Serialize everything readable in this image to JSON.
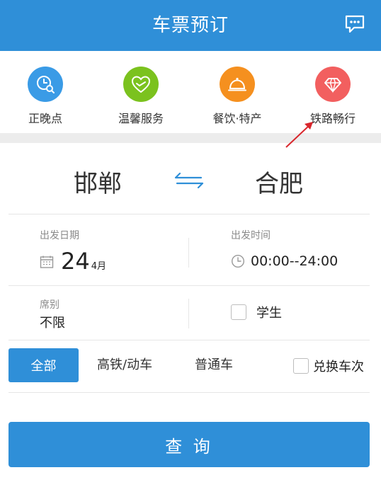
{
  "header": {
    "title": "车票预订",
    "chat_icon": "chat-bubble-icon"
  },
  "services": [
    {
      "label": "正晚点",
      "icon": "clock-search-icon",
      "color": "#3a9be6"
    },
    {
      "label": "温馨服务",
      "icon": "heart-handshake-icon",
      "color": "#7bc21e"
    },
    {
      "label": "餐饮·特产",
      "icon": "food-cloche-icon",
      "color": "#f5901f"
    },
    {
      "label": "铁路畅行",
      "icon": "diamond-icon",
      "color": "#f25f5f"
    }
  ],
  "route": {
    "from": "邯郸",
    "to": "合肥",
    "swap_icon": "swap-arrows-icon"
  },
  "departure_date": {
    "label": "出发日期",
    "day": "24",
    "month": "4月",
    "icon": "calendar-icon"
  },
  "departure_time": {
    "label": "出发时间",
    "value": "00:00--24:00",
    "icon": "clock-icon"
  },
  "seat": {
    "label": "席别",
    "value": "不限"
  },
  "student": {
    "label": "学生",
    "checked": false
  },
  "train_types": {
    "all": "全部",
    "high_speed": "高铁/动车",
    "normal": "普通车",
    "selected": "全部"
  },
  "exchange": {
    "label": "兑换车次",
    "checked": false
  },
  "query_button": {
    "label": "查 询"
  },
  "colors": {
    "primary": "#2f8fd8",
    "annotation_arrow": "#d9262c"
  }
}
